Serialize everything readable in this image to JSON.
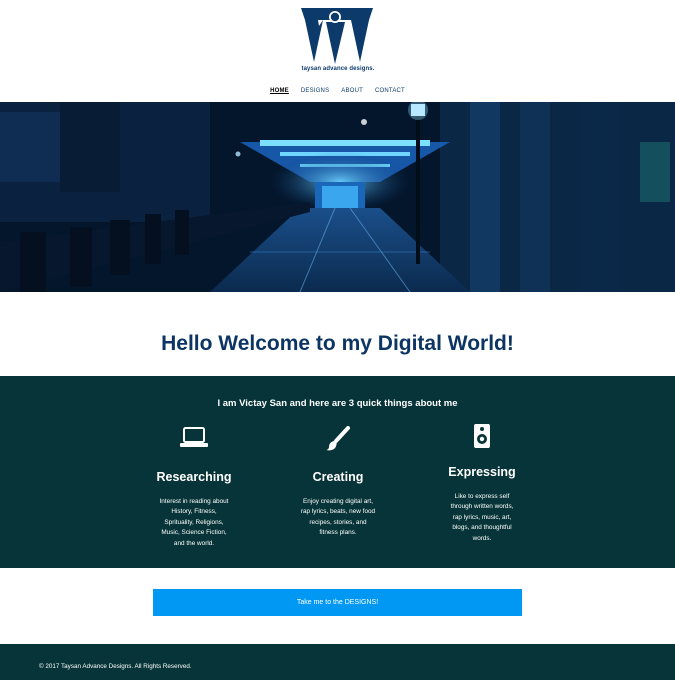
{
  "header": {
    "logo_text": "taysan advance designs.",
    "nav": [
      {
        "label": "HOME",
        "active": true
      },
      {
        "label": "DESIGNS",
        "active": false
      },
      {
        "label": "ABOUT",
        "active": false
      },
      {
        "label": "CONTACT",
        "active": false
      }
    ]
  },
  "welcome": {
    "title": "Hello Welcome to my Digital World!"
  },
  "about": {
    "intro": "I am Victay San and here are 3 quick things about me",
    "features": [
      {
        "icon": "laptop-icon",
        "title": "Researching",
        "text_lines": [
          "Interest in reading about",
          "History, Fitness,",
          "Sprituality, Religions,",
          "Music, Science Fiction,",
          "and the world."
        ]
      },
      {
        "icon": "paintbrush-icon",
        "title": "Creating",
        "text_lines": [
          "Enjoy creating digital art,",
          "rap lyrics, beats, new food",
          "recipes, stories, and",
          "fitness plans."
        ]
      },
      {
        "icon": "speaker-icon",
        "title": "Expressing",
        "text_lines": [
          "Like to express self",
          "through written words,",
          "rap lyrics, music, art,",
          "blogs, and thoughtful",
          "words."
        ]
      }
    ]
  },
  "cta": {
    "label": "Take me to the DESIGNS!"
  },
  "footer": {
    "copyright": "© 2017 Taysan Advance Designs. All Rights Reserved."
  },
  "colors": {
    "brand_navy": "#0b3a6b",
    "section_teal": "#073438",
    "cta_blue": "#0098f2"
  }
}
